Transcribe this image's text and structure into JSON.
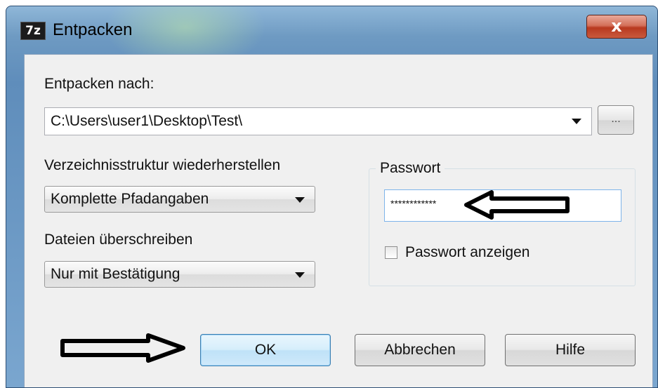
{
  "window": {
    "app_icon_text": "7z",
    "title": "Entpacken",
    "close_label": "x"
  },
  "extract_to": {
    "label": "Entpacken nach:",
    "path": "C:\\Users\\user1\\Desktop\\Test\\",
    "browse_label": "..."
  },
  "path_structure": {
    "label": "Verzeichnisstruktur wiederherstellen",
    "selected": "Komplette Pfadangaben"
  },
  "overwrite": {
    "label": "Dateien überschreiben",
    "selected": "Nur mit Bestätigung"
  },
  "password": {
    "group_label": "Passwort",
    "value": "************",
    "show_label": "Passwort anzeigen",
    "show_checked": false
  },
  "buttons": {
    "ok": "OK",
    "cancel": "Abbrechen",
    "help": "Hilfe"
  }
}
